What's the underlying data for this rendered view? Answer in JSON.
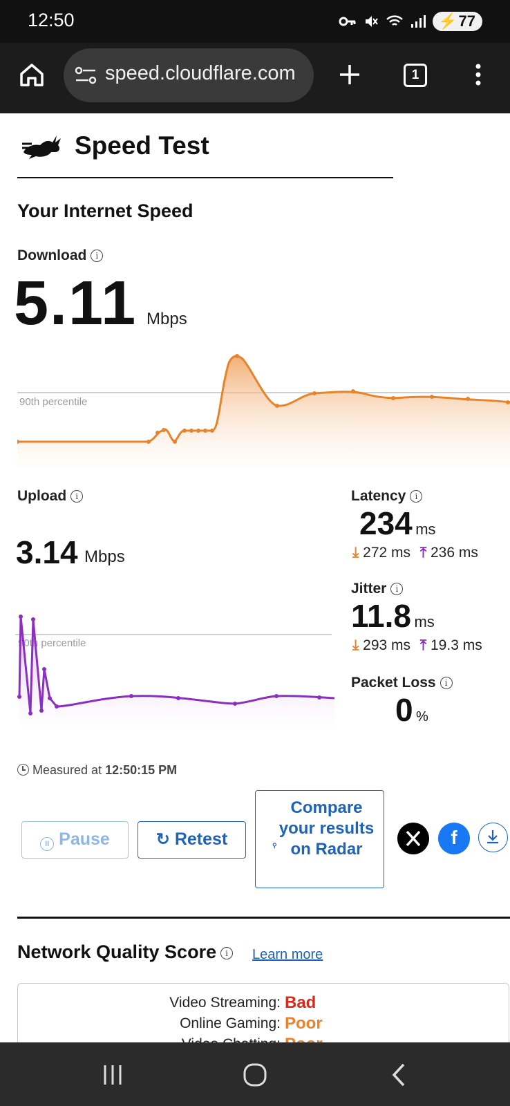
{
  "status_bar": {
    "time": "12:50",
    "battery": "77"
  },
  "browser": {
    "url": "speed.cloudflare.com",
    "tab_count": "1"
  },
  "app": {
    "title": "Speed Test"
  },
  "section_title": "Your Internet Speed",
  "download": {
    "label": "Download",
    "value": "5.11",
    "unit": "Mbps",
    "percentile_label": "90th percentile",
    "series_color": "#e8832a"
  },
  "upload": {
    "label": "Upload",
    "value": "3.14",
    "unit": "Mbps",
    "percentile_label": "90th percentile",
    "series_color": "#8a2fbf"
  },
  "latency": {
    "label": "Latency",
    "value": "234",
    "unit": "ms",
    "down": "272 ms",
    "up": "236 ms"
  },
  "jitter": {
    "label": "Jitter",
    "value": "11.8",
    "unit": "ms",
    "down": "293 ms",
    "up": "19.3 ms"
  },
  "packet_loss": {
    "label": "Packet Loss",
    "value": "0",
    "unit": "%"
  },
  "measured": {
    "prefix": "Measured at",
    "time": "12:50:15 PM"
  },
  "buttons": {
    "pause": "Pause",
    "retest": "Retest",
    "radar": "Compare your results on Radar"
  },
  "network_quality": {
    "title": "Network Quality Score",
    "learn_more": "Learn more",
    "rows": [
      {
        "label": "Video Streaming:",
        "value": "Bad",
        "color": "#d42b1e"
      },
      {
        "label": "Online Gaming:",
        "value": "Poor",
        "color": "#e8832a"
      },
      {
        "label": "Video Chatting:",
        "value": "Poor",
        "color": "#e8832a"
      }
    ]
  }
}
